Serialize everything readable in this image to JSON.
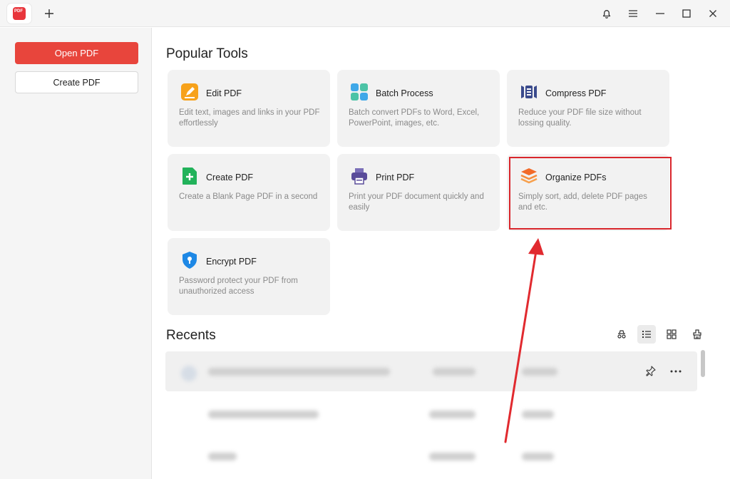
{
  "sidebar": {
    "open_label": "Open PDF",
    "create_label": "Create PDF"
  },
  "main": {
    "popular_title": "Popular Tools",
    "recents_title": "Recents",
    "tools": [
      {
        "title": "Edit PDF",
        "desc": "Edit text, images and links in your PDF effortlessly",
        "icon": "edit-pen-icon"
      },
      {
        "title": "Batch Process",
        "desc": "Batch convert PDFs to Word, Excel, PowerPoint, images, etc.",
        "icon": "batch-grid-icon"
      },
      {
        "title": "Compress PDF",
        "desc": "Reduce your PDF file size without lossing quality.",
        "icon": "compress-icon"
      },
      {
        "title": "Create PDF",
        "desc": "Create a Blank Page PDF in a second",
        "icon": "create-plus-icon"
      },
      {
        "title": "Print PDF",
        "desc": "Print your PDF document quickly and easily",
        "icon": "printer-icon"
      },
      {
        "title": "Organize PDFs",
        "desc": "Simply sort, add, delete PDF pages and etc.",
        "icon": "layers-icon"
      },
      {
        "title": "Encrypt PDF",
        "desc": "Password protect your PDF from unauthorized access",
        "icon": "shield-lock-icon"
      }
    ]
  },
  "colors": {
    "accent": "#e8453c",
    "annotation": "#d9262c"
  }
}
